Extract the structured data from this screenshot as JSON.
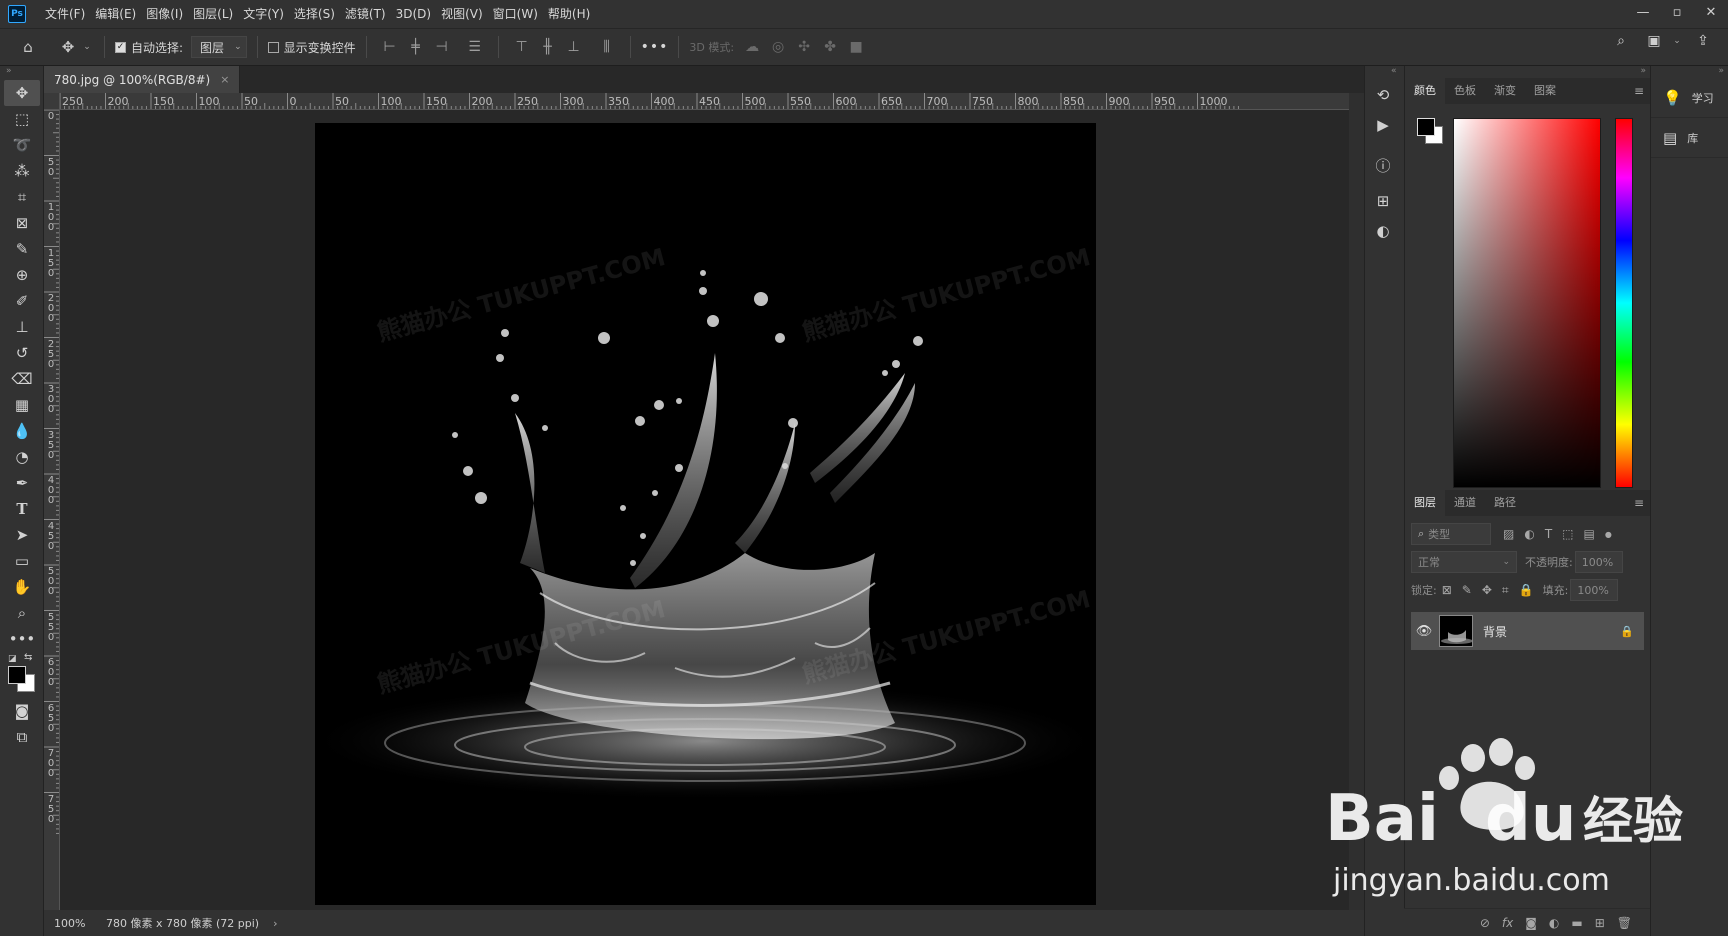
{
  "app": {
    "logo": "Ps"
  },
  "menu": [
    "文件(F)",
    "编辑(E)",
    "图像(I)",
    "图层(L)",
    "文字(Y)",
    "选择(S)",
    "滤镜(T)",
    "3D(D)",
    "视图(V)",
    "窗口(W)",
    "帮助(H)"
  ],
  "window_controls": {
    "minimize": "—",
    "restore": "▫",
    "close": "✕"
  },
  "options": {
    "auto_select_label": "自动选择:",
    "auto_select_checked": true,
    "auto_select_target": "图层",
    "show_transform_label": "显示变换控件",
    "mode_3d_label": "3D 模式:",
    "more": "•••"
  },
  "document": {
    "tab_title": "780.jpg @ 100%(RGB/8#)",
    "close": "×",
    "watermarks": [
      "熊猫办公 TUKUPPT.COM",
      "熊猫办公 TUKUPPT.COM",
      "熊猫办公 TUKUPPT.COM",
      "熊猫办公 TUKUPPT.COM"
    ]
  },
  "ruler": {
    "top_ticks": [
      "250",
      "200",
      "150",
      "100",
      "50",
      "0",
      "50",
      "100",
      "150",
      "200",
      "250",
      "300",
      "350",
      "400",
      "450",
      "500",
      "550",
      "600",
      "650",
      "700",
      "750",
      "800",
      "850",
      "900",
      "950",
      "1000"
    ],
    "left_ticks": [
      "0",
      "5\n0",
      "1\n0\n0",
      "1\n5\n0",
      "2\n0\n0",
      "2\n5\n0",
      "3\n0\n0",
      "3\n5\n0",
      "4\n0\n0",
      "4\n5\n0",
      "5\n0\n0",
      "5\n5\n0",
      "6\n0\n0",
      "6\n5\n0",
      "7\n0\n0",
      "7\n5\n0"
    ]
  },
  "status": {
    "zoom": "100%",
    "info": "780 像素 x 780 像素 (72 ppi)",
    "arrow": "›"
  },
  "panels": {
    "color_tabs": [
      "颜色",
      "色板",
      "渐变",
      "图案"
    ],
    "layers_tabs": [
      "图层",
      "通道",
      "路径"
    ],
    "filter_placeholder": "类型",
    "blend_mode": "正常",
    "opacity_label": "不透明度:",
    "opacity_value": "100%",
    "lock_label": "锁定:",
    "fill_label": "填充:",
    "fill_value": "100%",
    "layer_name": "背景"
  },
  "learn": {
    "learn_label": "学习",
    "library_label": "库"
  },
  "watermark": {
    "brand": "Bai",
    "brand2": "du",
    "brand_cn": "经验",
    "url": "jingyan.baidu.com"
  },
  "colors": {
    "foreground": "#000000",
    "background": "#ffffff",
    "accent": "#31a8ff"
  }
}
